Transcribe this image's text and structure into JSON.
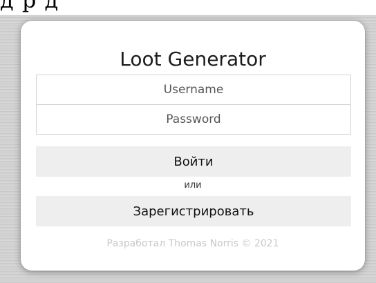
{
  "header_strip": {
    "partial_text": "д                                         р          д"
  },
  "login_card": {
    "title": "Loot Generator",
    "username": {
      "value": "",
      "placeholder": "Username"
    },
    "password": {
      "value": "",
      "placeholder": "Password"
    },
    "login_button_label": "Войти",
    "separator_text": "или",
    "register_button_label": "Зарегистрировать",
    "footer_text": "Разработал Thomas Norris © 2021"
  }
}
